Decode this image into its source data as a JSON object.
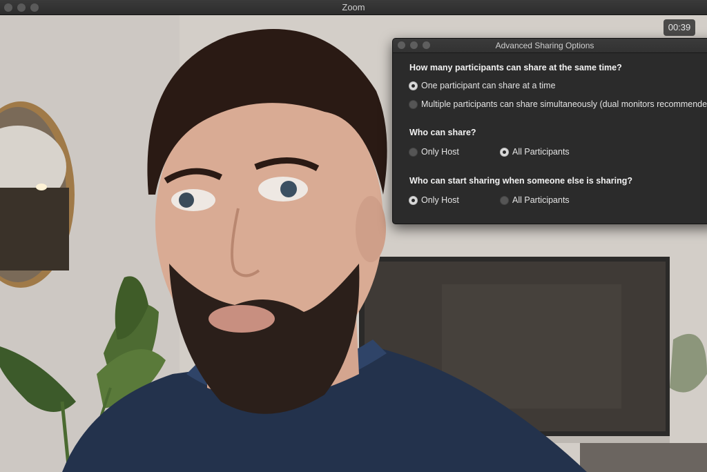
{
  "window": {
    "title": "Zoom",
    "timer": "00:39"
  },
  "dialog": {
    "title": "Advanced Sharing Options",
    "q1": {
      "label": "How many participants can share at the same time?",
      "options": [
        {
          "label": "One participant can share at a time",
          "selected": true
        },
        {
          "label": "Multiple participants can share simultaneously (dual monitors recommended)",
          "selected": false
        }
      ]
    },
    "q2": {
      "label": "Who can share?",
      "options": [
        {
          "label": "Only Host",
          "selected": false
        },
        {
          "label": "All Participants",
          "selected": true
        }
      ]
    },
    "q3": {
      "label": "Who can start sharing when someone else is sharing?",
      "options": [
        {
          "label": "Only Host",
          "selected": true
        },
        {
          "label": "All Participants",
          "selected": false
        }
      ]
    }
  }
}
